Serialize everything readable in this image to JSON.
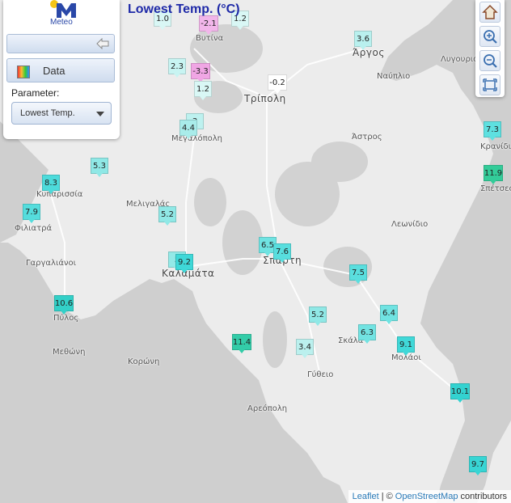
{
  "title": "Lowest Temp. (°C)",
  "logo": {
    "text": "Meteo"
  },
  "panel": {
    "data_label": "Data",
    "parameter_label": "Parameter:",
    "parameter_value": "Lowest Temp."
  },
  "attribution": {
    "leaflet": "Leaflet",
    "separator": "| ©",
    "osm": "OpenStreetMap",
    "contributors": "contributors"
  },
  "places": [
    {
      "name": "Βυτίνα",
      "big": false
    },
    {
      "name": "Άργος",
      "big": true
    },
    {
      "name": "Λυγουριό",
      "big": false
    },
    {
      "name": "Ναύπλιο",
      "big": false
    },
    {
      "name": "Τρίπολη",
      "big": true
    },
    {
      "name": "Μεγαλόπολη",
      "big": false
    },
    {
      "name": "Άστρος",
      "big": false
    },
    {
      "name": "Κρανίδι",
      "big": false
    },
    {
      "name": "Σπέτσες",
      "big": false
    },
    {
      "name": "Κυπαρισσία",
      "big": false
    },
    {
      "name": "Μελιγαλάς",
      "big": false
    },
    {
      "name": "Φιλιατρά",
      "big": false
    },
    {
      "name": "Λεωνίδιο",
      "big": false
    },
    {
      "name": "Γαργαλιάνοι",
      "big": false
    },
    {
      "name": "Σπάρτη",
      "big": true
    },
    {
      "name": "Καλαμάτα",
      "big": true
    },
    {
      "name": "Πύλος",
      "big": false
    },
    {
      "name": "Σκάλα",
      "big": false
    },
    {
      "name": "Μολάοι",
      "big": false
    },
    {
      "name": "Μεθώνη",
      "big": false
    },
    {
      "name": "Κορώνη",
      "big": false
    },
    {
      "name": "Γύθειο",
      "big": false
    },
    {
      "name": "Αρεόπολη",
      "big": false
    }
  ],
  "stations": [
    {
      "value": "1.0",
      "color": "#d9f7f5"
    },
    {
      "value": "-2.1",
      "color": "#f2b6ea"
    },
    {
      "value": "1.2",
      "color": "#d9f7f5"
    },
    {
      "value": "3.6",
      "color": "#b9f0ee"
    },
    {
      "value": "2.3",
      "color": "#c8f4f2"
    },
    {
      "value": "-3.3",
      "color": "#f0a6e4"
    },
    {
      "value": "1.2",
      "color": "#d9f7f5"
    },
    {
      "value": "-0.2",
      "color": "#ffffff"
    },
    {
      "value": "3",
      "color": "#bdf1ef"
    },
    {
      "value": "4.4",
      "color": "#a9ecea"
    },
    {
      "value": "7.3",
      "color": "#5ee0e0"
    },
    {
      "value": "5.3",
      "color": "#8fe8e6"
    },
    {
      "value": "8.3",
      "color": "#4ddbdb"
    },
    {
      "value": "11.9",
      "color": "#33cc99"
    },
    {
      "value": "7.9",
      "color": "#55dddd"
    },
    {
      "value": "5.2",
      "color": "#90e8e6"
    },
    {
      "value": "6.5",
      "color": "#6fe3e2"
    },
    {
      "value": "7.6",
      "color": "#58dede"
    },
    {
      "value": "5",
      "color": "#93e9e7"
    },
    {
      "value": "9.2",
      "color": "#3fd8d8"
    },
    {
      "value": "7.5",
      "color": "#5adede"
    },
    {
      "value": "10.6",
      "color": "#33d0c8"
    },
    {
      "value": "5.2",
      "color": "#90e8e6"
    },
    {
      "value": "6.4",
      "color": "#70e3e2"
    },
    {
      "value": "6.3",
      "color": "#72e3e2"
    },
    {
      "value": "11.4",
      "color": "#33cca8"
    },
    {
      "value": "3.4",
      "color": "#bbf0ee"
    },
    {
      "value": "9.1",
      "color": "#40d8d8"
    },
    {
      "value": "10.1",
      "color": "#33d2d0"
    },
    {
      "value": "9.7",
      "color": "#38d5d4"
    }
  ]
}
